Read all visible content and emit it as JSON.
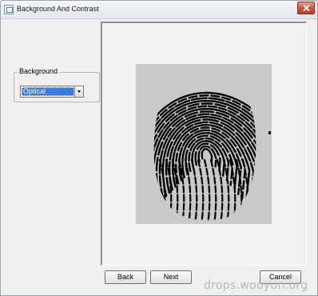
{
  "window": {
    "title": "Background And Contrast"
  },
  "background_group": {
    "legend": "Background",
    "select": {
      "selected": "Optical"
    }
  },
  "preview": {
    "image_subject": "fingerprint-scan",
    "colors": {
      "image_background": "#c9c9c9",
      "ridge": "#000000"
    }
  },
  "buttons": {
    "back": "Back",
    "next": "Next",
    "cancel": "Cancel"
  },
  "watermark": {
    "text": "drops.wooyun.org"
  },
  "colors": {
    "selection": "#3a7ce4",
    "close_button": "#c8513c",
    "window_background": "#f0efee"
  }
}
